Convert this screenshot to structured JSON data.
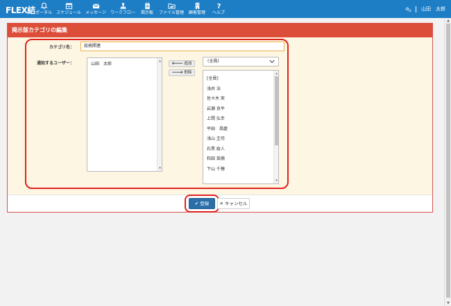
{
  "app": {
    "logo": "FLEX結"
  },
  "nav": [
    {
      "label": "ポータル",
      "icon": "bell-icon"
    },
    {
      "label": "スケジュール",
      "icon": "calendar-icon"
    },
    {
      "label": "メッセージ",
      "icon": "envelope-icon"
    },
    {
      "label": "ワークフロー",
      "icon": "stamp-icon"
    },
    {
      "label": "掲示板",
      "icon": "clipboard-icon"
    },
    {
      "label": "ファイル管理",
      "icon": "folder-icon"
    },
    {
      "label": "顧客管理",
      "icon": "building-icon"
    },
    {
      "label": "ヘルプ",
      "icon": "question-icon"
    }
  ],
  "user": {
    "name": "山田　太郎",
    "icon": "gears-icon"
  },
  "panel": {
    "title": "掲示版カテゴリの編集"
  },
  "form": {
    "category_label": "カテゴリ名：",
    "category_value": "総務関連",
    "notify_label": "通知するユーザー：",
    "selected_users": [
      "山田　太郎"
    ],
    "add_label": "追加",
    "remove_label": "削除",
    "filter_value": "(全員)",
    "candidates": [
      "[全員]",
      "浅井 治",
      "佐々木 実",
      "岩瀬 良平",
      "上間 弘幸",
      "平田　昌慶",
      "浅山 圭司",
      "石黒 政人",
      "和田 菜摘",
      "下山 千穂"
    ]
  },
  "footer": {
    "save_label": "登録",
    "cancel_label": "キャンセル"
  },
  "colors": {
    "topbar": "#1d7ec6",
    "panel_header": "#dc4e3a",
    "highlight": "#e0201a",
    "save": "#2a6fa8"
  }
}
